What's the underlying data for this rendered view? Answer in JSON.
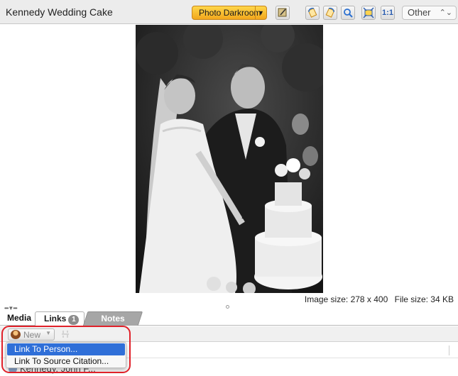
{
  "window": {
    "title": "Kennedy Wedding Cake"
  },
  "toolbar": {
    "darkroom_label": "Photo Darkroom",
    "zoom_actual_label": "1:1",
    "view_select_value": "Other",
    "tools": [
      "edit-photo-icon",
      "rotate-left-icon",
      "rotate-right-icon",
      "zoom-icon",
      "fit-window-icon"
    ]
  },
  "photo": {
    "size_text": "Image size: 278 x 400",
    "file_size_text": "File size: 34 KB"
  },
  "tabs": {
    "media": "Media",
    "links": "Links",
    "links_count": "1",
    "notes": "Notes"
  },
  "links_toolbar": {
    "new_label": "New"
  },
  "dropdown": {
    "items": [
      "Link To Person...",
      "Link To Source Citation..."
    ]
  },
  "list": {
    "rows": [
      {
        "name": "Kennedy, John F..."
      }
    ]
  },
  "colors": {
    "darkroom_button": "#f2a71c",
    "menu_selection": "#2f6fd8",
    "annotation": "#e0212a"
  }
}
